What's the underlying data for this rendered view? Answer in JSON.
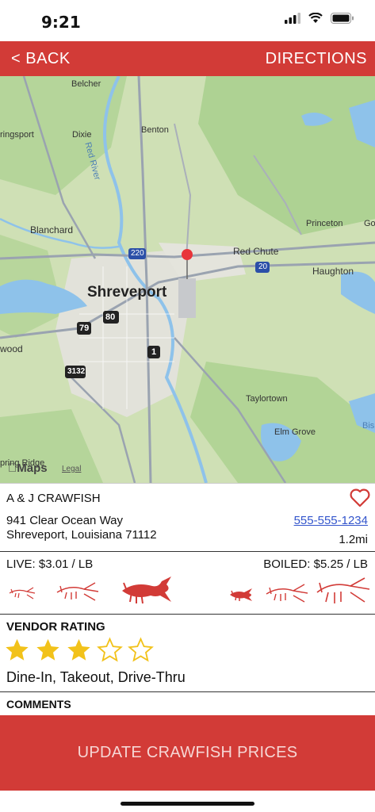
{
  "status_bar": {
    "time": "9:21"
  },
  "nav": {
    "back_label": "< BACK",
    "directions_label": "DIRECTIONS"
  },
  "map": {
    "attribution": "Maps",
    "legal": "Legal",
    "labels": {
      "belcher": "Belcher",
      "benton": "Benton",
      "ringsport": "ringsport",
      "dixie": "Dixie",
      "red_river": "Red River",
      "princeton": "Princeton",
      "go": "Go",
      "blanchard": "Blanchard",
      "red_chute": "Red Chute",
      "haughton": "Haughton",
      "shreveport": "Shreveport",
      "wood": "wood",
      "taylortown": "Taylortown",
      "elm_grove": "Elm Grove",
      "spring_ridge": "pring Ridge",
      "bis": "Bis",
      "route_220": "220",
      "route_20": "20",
      "route_79": "79",
      "route_80": "80",
      "route_1": "1",
      "route_3132": "3132"
    }
  },
  "vendor": {
    "name": "A & J CRAWFISH",
    "address_line1": "941 Clear Ocean Way",
    "address_line2": "Shreveport, Louisiana 71112",
    "phone": "555-555-1234",
    "distance": "1.2mi"
  },
  "prices": {
    "live": "LIVE: $3.01 / LB",
    "boiled": "BOILED: $5.25 / LB"
  },
  "rating": {
    "title": "VENDOR RATING",
    "stars": 3,
    "max": 5,
    "services": "Dine-In, Takeout, Drive-Thru"
  },
  "comments_label": "COMMENTS",
  "update_button_label": "UPDATE CRAWFISH PRICES",
  "colors": {
    "brand_red": "#d23b37",
    "star_gold": "#f2c21a",
    "link_blue": "#3355cc"
  }
}
